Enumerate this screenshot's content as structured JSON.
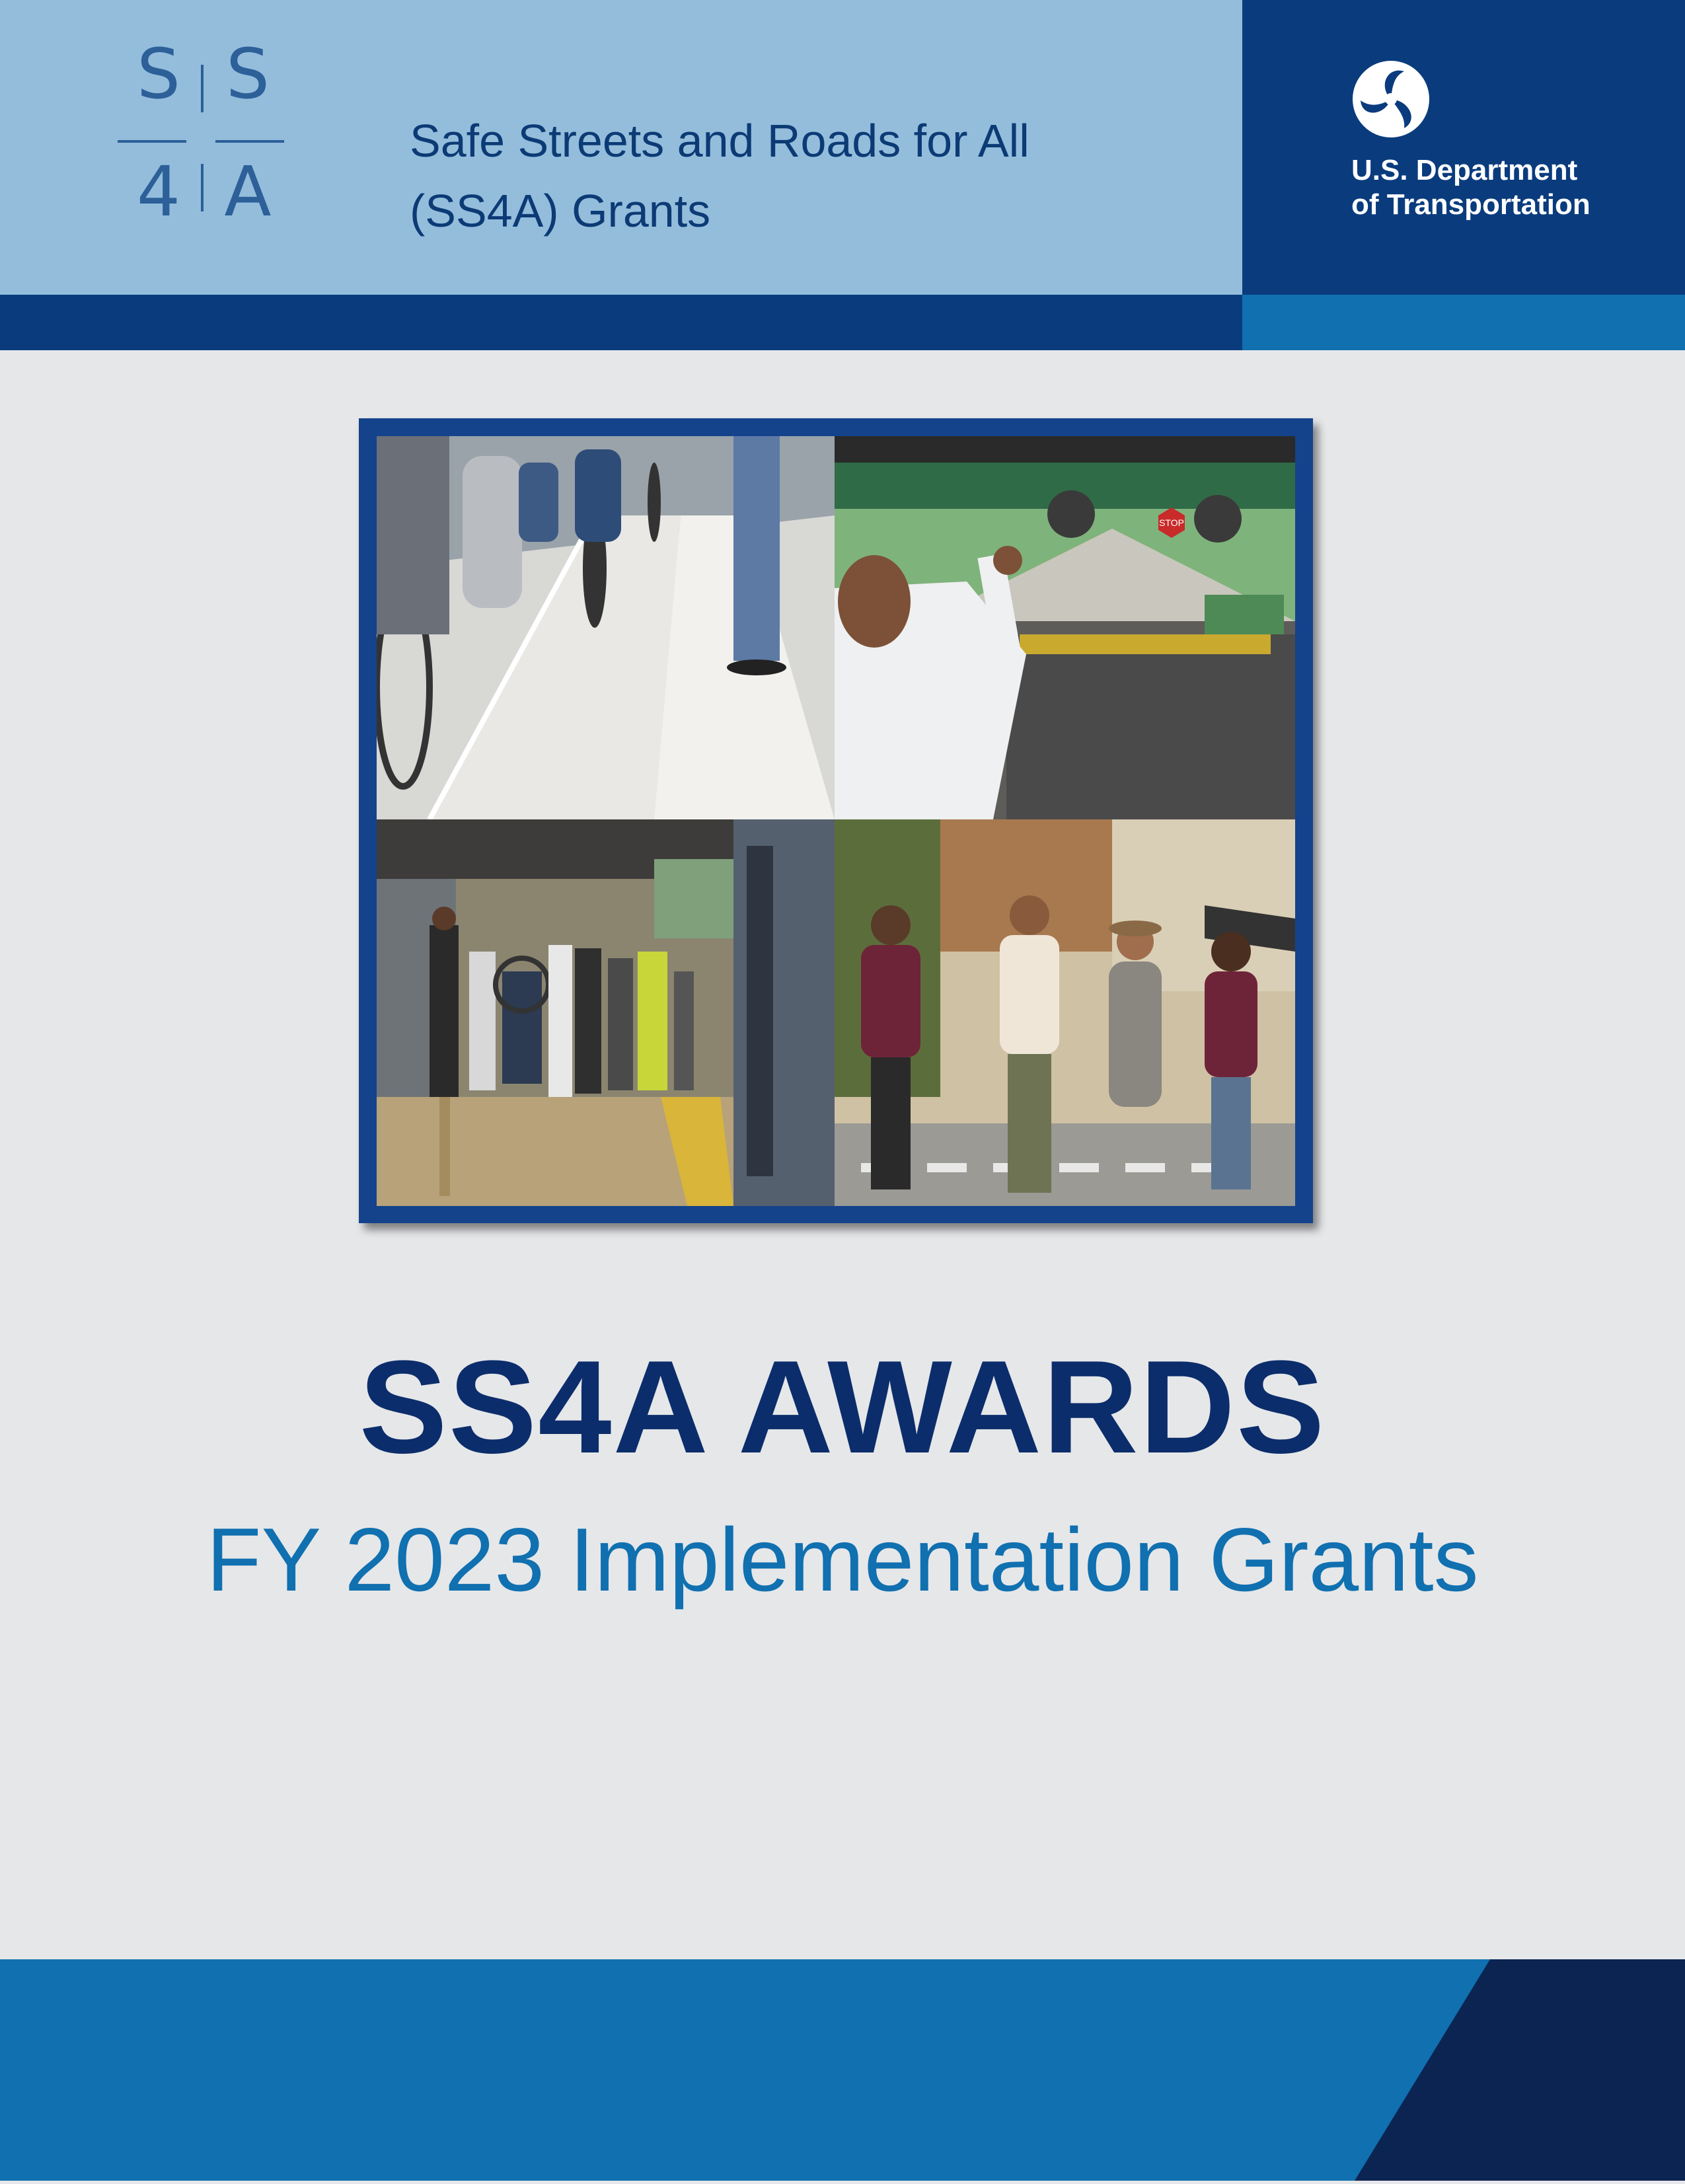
{
  "logo": {
    "letters": [
      "S",
      "S",
      "4",
      "A"
    ]
  },
  "header": {
    "title_line1": "Safe Streets and Roads for All",
    "title_line2": "(SS4A) Grants"
  },
  "agency": {
    "line1": "U.S. Department",
    "line2": "of Transportation"
  },
  "photos": {
    "bus_sign": "STOP"
  },
  "main": {
    "title": "SS4A AWARDS",
    "subtitle": "FY 2023 Implementation Grants"
  },
  "colors": {
    "header_light": "#93bddb",
    "header_dark": "#0a3c7d",
    "accent_blue": "#1070b0",
    "footer_dark": "#0b2452",
    "title_navy": "#0c2d6b",
    "background": "#e6e7e9"
  }
}
